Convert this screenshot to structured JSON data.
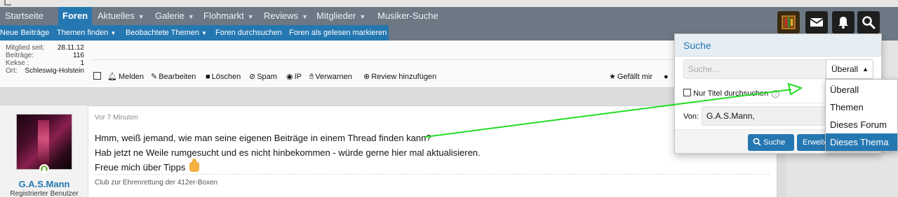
{
  "nav": {
    "startseite": "Startseite",
    "foren": "Foren",
    "items": [
      {
        "label": "Aktuelles",
        "dropdown": true
      },
      {
        "label": "Galerie",
        "dropdown": true
      },
      {
        "label": "Flohmarkt",
        "dropdown": true
      },
      {
        "label": "Reviews",
        "dropdown": true
      },
      {
        "label": "Mitglieder",
        "dropdown": true
      },
      {
        "label": "Musiker-Suche",
        "dropdown": false
      }
    ],
    "caret": "▼"
  },
  "subnav": {
    "new_posts": "Neue Beiträge",
    "find_threads": "Themen finden",
    "watched_threads": "Beobachtete Themen",
    "search_forums": "Foren durchsuchen",
    "mark_read": "Foren als gelesen markieren",
    "caret": "▼"
  },
  "header_icons": [
    "user-avatar-icon",
    "envelope-icon",
    "bell-icon",
    "search-icon"
  ],
  "post1": {
    "userinfo": [
      {
        "label": "Mitglied seit:",
        "value": "28.11.12"
      },
      {
        "label": "Beiträge:",
        "value": "116"
      },
      {
        "label": "Kekse :",
        "value": "1"
      },
      {
        "label": "Ort:",
        "value": "Schleswig-Holstein"
      }
    ],
    "actions": {
      "report": "Melden",
      "edit": "Bearbeiten",
      "delete": "Löschen",
      "spam": "Spam",
      "ip": "IP",
      "warn": "Verwarnen",
      "add_review": "Review hinzufügen",
      "like": "Gefällt mir"
    }
  },
  "post2": {
    "time": "Vor 7 Minuten",
    "lines": [
      "Hmm, weiß jemand, wie man seine eigenen Beiträge in einem Thread finden kann?",
      "Hab jetzt ne Weile rumgesucht und es nicht hinbekommen - würde gerne hier mal aktualisieren.",
      "Freue mich über Tipps"
    ],
    "signature": "Club zur Ehrenrettung der 412er-Boxen",
    "username": "G.A.S.Mann",
    "user_title": "Registrierter Benutzer"
  },
  "search": {
    "title": "Suche",
    "placeholder": "Suche...",
    "scope_selected": "Überall",
    "titles_only": "Nur Titel durchsuchen",
    "von_label": "Von:",
    "von_value": "G.A.S.Mann,",
    "search_button": "Suche",
    "advanced_button": "Erweiterte Suche",
    "scope_options": [
      "Überall",
      "Themen",
      "Dieses Forum",
      "Dieses Thema"
    ],
    "highlighted_option": "Dieses Thema"
  },
  "colors": {
    "nav_bg": "#6c7883",
    "accent": "#2577b1",
    "annotation_arrow": "#22dd22"
  }
}
